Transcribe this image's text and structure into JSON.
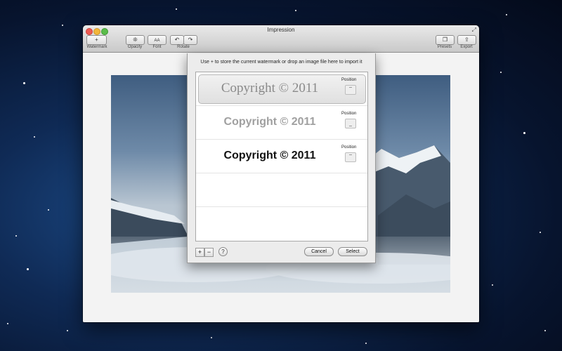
{
  "window": {
    "title": "Impression"
  },
  "toolbar": {
    "watermark": {
      "label": "Watermark",
      "icon": "plus-icon",
      "glyph": "+"
    },
    "opacity": {
      "label": "Opacity",
      "icon": "opacity-icon",
      "glyph": "❊"
    },
    "font": {
      "label": "Font",
      "icon": "font-icon",
      "glyph": "AA"
    },
    "rotate": {
      "label": "Rotate",
      "icon_left": "rotate-left-icon",
      "icon_right": "rotate-right-icon",
      "glyph_left": "↶",
      "glyph_right": "↷"
    },
    "presets": {
      "label": "Presets",
      "icon": "presets-icon",
      "glyph": "❐"
    },
    "export": {
      "label": "Export",
      "icon": "export-icon",
      "glyph": "⇪"
    }
  },
  "sheet": {
    "message": "Use + to store the current watermark or drop an image file here to import it",
    "items": [
      {
        "text": "Copyright © 2011",
        "position_label": "Position",
        "selected": true,
        "color": "#8a8a8a"
      },
      {
        "text": "Copyright © 2011",
        "position_label": "Position",
        "selected": false,
        "color": "#a0a0a0"
      },
      {
        "text": "Copyright © 2011",
        "position_label": "Position",
        "selected": false,
        "color": "#111111"
      }
    ],
    "add_glyph": "+",
    "remove_glyph": "−",
    "help_glyph": "?",
    "cancel_label": "Cancel",
    "select_label": "Select"
  },
  "colors": {
    "traffic_close": "#ee5a52",
    "traffic_min": "#f2b63a",
    "traffic_max": "#5bbd4b"
  }
}
